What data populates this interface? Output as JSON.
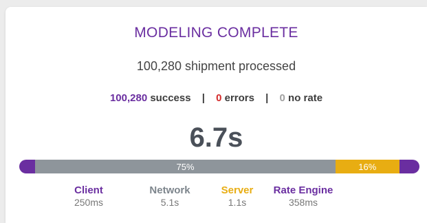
{
  "header": {
    "title": "MODELING COMPLETE",
    "subtitle": "100,280 shipment processed"
  },
  "counts": {
    "success_value": "100,280",
    "success_label": "success",
    "separator": "|",
    "errors_value": "0",
    "errors_label": "errors",
    "norate_value": "0",
    "norate_label": "no rate"
  },
  "total_time": "6.7s",
  "colors": {
    "client": "#6a2ea0",
    "network": "#8e959b",
    "server": "#e8ad12",
    "rate_engine": "#6a2ea0",
    "errors": "#d42a2a",
    "no_rate": "#a0a0a0"
  },
  "timing_bar": {
    "segments": [
      {
        "name": "Client",
        "label": "",
        "fraction": 0.04
      },
      {
        "name": "Network",
        "label": "75%",
        "fraction": 0.75
      },
      {
        "name": "Server",
        "label": "16%",
        "fraction": 0.16
      },
      {
        "name": "Rate Engine",
        "label": "",
        "fraction": 0.05
      }
    ]
  },
  "legend": [
    {
      "name": "Client",
      "value": "250ms"
    },
    {
      "name": "Network",
      "value": "5.1s"
    },
    {
      "name": "Server",
      "value": "1.1s"
    },
    {
      "name": "Rate Engine",
      "value": "358ms"
    }
  ]
}
